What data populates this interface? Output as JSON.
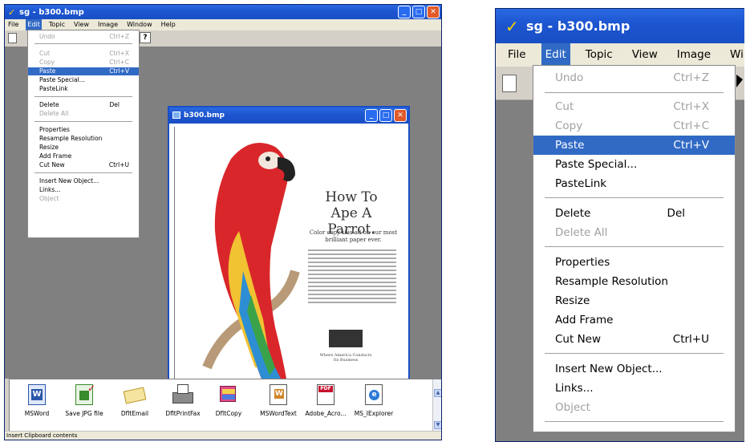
{
  "app": {
    "check_glyph": "✓",
    "title": "sg - b300.bmp",
    "child_title": "b300.bmp",
    "status": "Insert Clipboard contents"
  },
  "menubar": {
    "left": [
      "File",
      "Edit",
      "Topic",
      "View",
      "Image",
      "Window",
      "Help"
    ],
    "right": [
      "File",
      "Edit",
      "Topic",
      "View",
      "Image",
      "Window"
    ],
    "active": "Edit"
  },
  "edit_menu": {
    "items": [
      {
        "label": "Undo",
        "shortcut": "Ctrl+Z",
        "disabled": true
      },
      {
        "label": "Cut",
        "shortcut": "Ctrl+X",
        "disabled": true
      },
      {
        "label": "Copy",
        "shortcut": "Ctrl+C",
        "disabled": true
      },
      {
        "label": "Paste",
        "shortcut": "Ctrl+V",
        "selected": true
      },
      {
        "label": "Paste Special...",
        "shortcut": ""
      },
      {
        "label": "PasteLink",
        "shortcut": ""
      },
      {
        "label": "Delete",
        "shortcut": "Del"
      },
      {
        "label": "Delete All",
        "shortcut": "",
        "disabled": true
      },
      {
        "label": "Properties",
        "shortcut": ""
      },
      {
        "label": "Resample Resolution",
        "shortcut": ""
      },
      {
        "label": "Resize",
        "shortcut": ""
      },
      {
        "label": "Add Frame",
        "shortcut": ""
      },
      {
        "label": "Cut New",
        "shortcut": "Ctrl+U"
      },
      {
        "label": "Insert New Object...",
        "shortcut": ""
      },
      {
        "label": "Links...",
        "shortcut": ""
      },
      {
        "label": "Object",
        "shortcut": "",
        "disabled": true
      }
    ]
  },
  "image_ad": {
    "headline_1": "How To",
    "headline_2": "Ape A Parrot.",
    "subline": "Color copy this ad on our most brilliant paper ever.",
    "footer": "Where America Conducts Its Business"
  },
  "shortcuts": [
    {
      "label": "MSWord",
      "icon": "msword-doc-icon",
      "color": "#2b55a8"
    },
    {
      "label": "Save JPG file",
      "icon": "jpg-file-icon",
      "color": "#3a8a2e"
    },
    {
      "label": "DfltEmail",
      "icon": "email-envelope-icon",
      "color": "#e6c24a"
    },
    {
      "label": "DfltPrintFax",
      "icon": "fax-printer-icon",
      "color": "#6c6c6c"
    },
    {
      "label": "DfltCopy",
      "icon": "copy-stack-icon",
      "color": "#c0396b"
    },
    {
      "label": "MSWordText",
      "icon": "word-text-icon",
      "color": "#d0862a"
    },
    {
      "label": "Adobe_Acro...",
      "icon": "pdf-file-icon",
      "color": "#c8102e"
    },
    {
      "label": "MS_IExplorer",
      "icon": "ie-browser-icon",
      "color": "#2b7ad8"
    }
  ],
  "colors": {
    "title_blue": "#1c55d0",
    "menu_selected": "#316ac5",
    "workspace_gray": "#808080",
    "close_red": "#e25a2a"
  }
}
